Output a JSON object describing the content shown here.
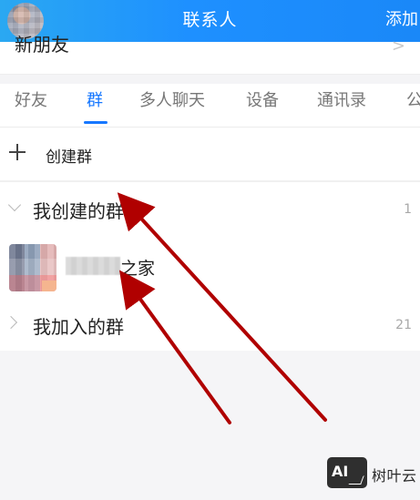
{
  "header": {
    "title": "联系人",
    "action_add": "添加"
  },
  "new_friends": {
    "label": "新朋友",
    "arrow": ">"
  },
  "tabs": [
    {
      "label": "好友",
      "active": false
    },
    {
      "label": "群",
      "active": true
    },
    {
      "label": "多人聊天",
      "active": false
    },
    {
      "label": "设备",
      "active": false
    },
    {
      "label": "通讯录",
      "active": false
    },
    {
      "label": "公",
      "active": false
    }
  ],
  "actions": {
    "create_group": "创建群"
  },
  "sections": {
    "created_groups": {
      "label": "我创建的群",
      "count": "1"
    },
    "group_item": {
      "name_suffix": "之家"
    },
    "joined_groups": {
      "label": "我加入的群",
      "count": "21"
    }
  },
  "watermark": {
    "logo_text": "AI",
    "name": "树叶云"
  },
  "colors": {
    "header_blue": "#1e90ff",
    "accent_blue": "#1677ff",
    "annotation_red": "#b00000"
  },
  "icons": {
    "plus": "plus-icon",
    "chevron_down": "chevron-down-icon",
    "chevron_right": "chevron-right-icon"
  }
}
